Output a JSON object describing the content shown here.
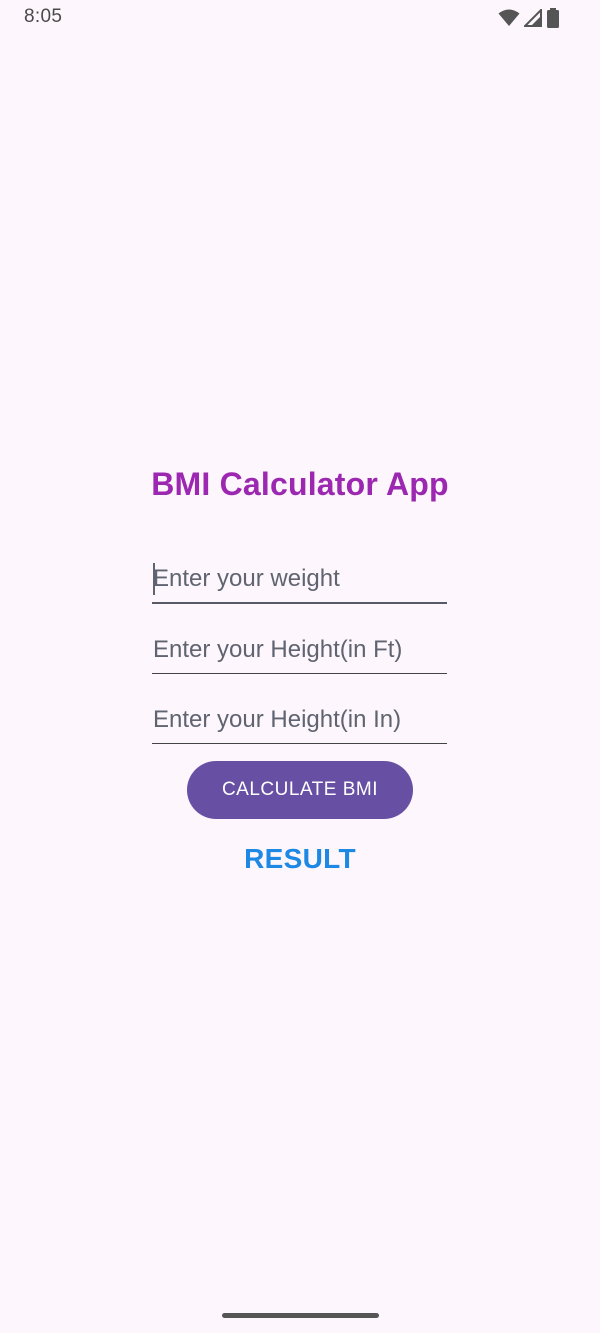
{
  "status_bar": {
    "time": "8:05",
    "icons": [
      "wifi-icon",
      "cellular-signal-icon",
      "battery-icon"
    ]
  },
  "app": {
    "title": "BMI Calculator App",
    "weight_placeholder": "Enter your weight",
    "height_ft_placeholder": "Enter your Height(in Ft)",
    "height_in_placeholder": "Enter your Height(in In)",
    "calculate_label": "CALCULATE BMI",
    "result_label": "RESULT"
  },
  "colors": {
    "background": "#fdf6fc",
    "title": "#9c27b0",
    "button": "#6750a4",
    "result": "#1e88e5"
  }
}
